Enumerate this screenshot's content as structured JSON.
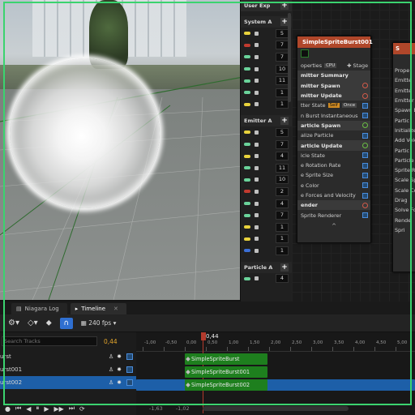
{
  "param_panel": {
    "header": "User Exp",
    "system_section": "System A",
    "system_rows": [
      {
        "color": "#e8d23c",
        "value": "5"
      },
      {
        "color": "#c23b2f",
        "value": "7"
      },
      {
        "color": "#6ad39a",
        "value": "7"
      },
      {
        "color": "#6ad39a",
        "value": "10"
      },
      {
        "color": "#6ad39a",
        "value": "11"
      },
      {
        "color": "#6ad39a",
        "value": "1"
      },
      {
        "color": "#e8d23c",
        "value": "1"
      }
    ],
    "emitter_section": "Emitter A",
    "emitter_rows": [
      {
        "color": "#e8d23c",
        "value": "5"
      },
      {
        "color": "#6ad39a",
        "value": "7"
      },
      {
        "color": "#e8d23c",
        "value": "4"
      },
      {
        "color": "#6ad39a",
        "value": "11"
      },
      {
        "color": "#6ad39a",
        "value": "10"
      },
      {
        "color": "#c23b2f",
        "value": "2"
      },
      {
        "color": "#6ad39a",
        "value": "4"
      },
      {
        "color": "#6ad39a",
        "value": "7"
      },
      {
        "color": "#e8d23c",
        "value": "1"
      },
      {
        "color": "#e8d23c",
        "value": "1"
      },
      {
        "color": "#3b6fd6",
        "value": "1"
      }
    ],
    "particle_section": "Particle A",
    "particle_rows": [
      {
        "color": "#6ad39a",
        "value": "4"
      }
    ]
  },
  "node_main": {
    "title": "SimpleSpriteBurst001",
    "properties_label": "operties",
    "stage_label": "Stage",
    "rows": [
      {
        "label": "mitter Summary",
        "kind": "group"
      },
      {
        "label": "mitter Spawn",
        "kind": "group-add"
      },
      {
        "label": "mitter Update",
        "kind": "group-add"
      },
      {
        "label": "tter State",
        "kind": "check",
        "tag1": "Self",
        "tag2": "Once"
      },
      {
        "label": "n Burst Instantaneous",
        "kind": "check"
      },
      {
        "label": "article Spawn",
        "kind": "group-add-green"
      },
      {
        "label": "alize Particle",
        "kind": "check"
      },
      {
        "label": "article Update",
        "kind": "group-add-green"
      },
      {
        "label": "icle State",
        "kind": "check"
      },
      {
        "label": "e Rotation Rate",
        "kind": "check"
      },
      {
        "label": "e Sprite Size",
        "kind": "check"
      },
      {
        "label": "e Color",
        "kind": "check"
      },
      {
        "label": "e Forces and Velocity",
        "kind": "check"
      },
      {
        "label": "ender",
        "kind": "group-add"
      },
      {
        "label": "Sprite Renderer",
        "kind": "check"
      }
    ],
    "collapse_glyph": "^"
  },
  "node_side": {
    "title": "S",
    "rows": [
      "Prope",
      "Emitte",
      "Emitte",
      "Emitter",
      "Spawn B",
      "Partic",
      "Initialize",
      "Add Velo",
      "Partic",
      "Particle",
      "Sprite R",
      "Scale Sp",
      "Scale Co",
      "Drag",
      "Solve Fo",
      "Rende",
      "Spri"
    ]
  },
  "tabs": [
    {
      "label": "Niagara Log",
      "active": false
    },
    {
      "label": "Timeline",
      "active": true
    }
  ],
  "timeline": {
    "fps_label": "240 fps",
    "search_placeholder": "Search Tracks",
    "current_time": "0,44",
    "playhead_label": "0,44",
    "tracks": [
      {
        "name": "urst",
        "selected": false
      },
      {
        "name": "urst001",
        "selected": false
      },
      {
        "name": "urst002",
        "selected": true
      }
    ],
    "ruler_ticks": [
      "-1,00",
      "-0,50",
      "0,00",
      "0,50",
      "1,00",
      "1,50",
      "2,00",
      "2,50",
      "3,00",
      "3,50",
      "4,00",
      "4,50",
      "5,00"
    ],
    "bars": [
      "SimpleSpriteBurst",
      "SimpleSpriteBurst001",
      "SimpleSpriteBurst002"
    ],
    "bottom_left": "-1,63",
    "bottom_mid": "-1,02"
  }
}
